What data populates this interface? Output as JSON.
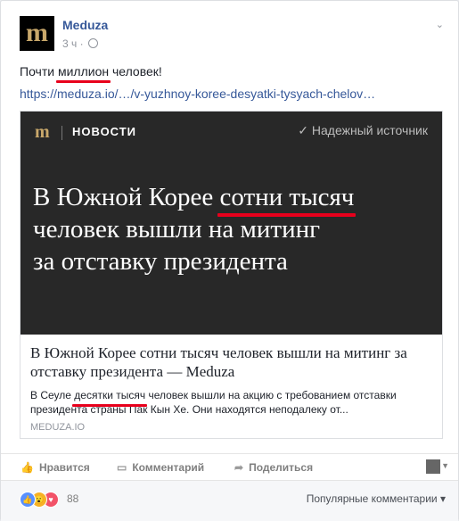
{
  "post": {
    "page_name": "Meduza",
    "avatar_letter": "m",
    "time": "3 ч ·",
    "text_before": "Почти ",
    "text_underlined": "миллион",
    "text_after": " человек!",
    "link_text": "https://meduza.io/…/v-yuzhnoy-koree-desyatki-tysyach-chelov…"
  },
  "card": {
    "logo": "m",
    "section": "НОВОСТИ",
    "badge": "Надежный источник",
    "hero_line1_before": "В Южной Корее ",
    "hero_line1_underlined": "сотни тысяч",
    "hero_line2": "человек вышли на митинг",
    "hero_line3": "за отставку президента",
    "caption_title": "В Южной Корее сотни тысяч человек вышли на митинг за отставку президента — Meduza",
    "desc_before": "В Сеуле ",
    "desc_underlined": "десятки тысяч",
    "desc_after": " человек вышли на акцию с требованием отставки президента страны Пак Кын Хе. Они находятся неподалеку от...",
    "domain": "MEDUZA.IO"
  },
  "actions": {
    "like": "Нравится",
    "comment": "Комментарий",
    "share": "Поделиться"
  },
  "reactions": {
    "count": "88",
    "sort": "Популярные комментарии ▾"
  },
  "colors": {
    "accent": "#365899",
    "underline": "#e8001c",
    "hero_bg": "#282828",
    "logo_gold": "#c9a86b"
  }
}
